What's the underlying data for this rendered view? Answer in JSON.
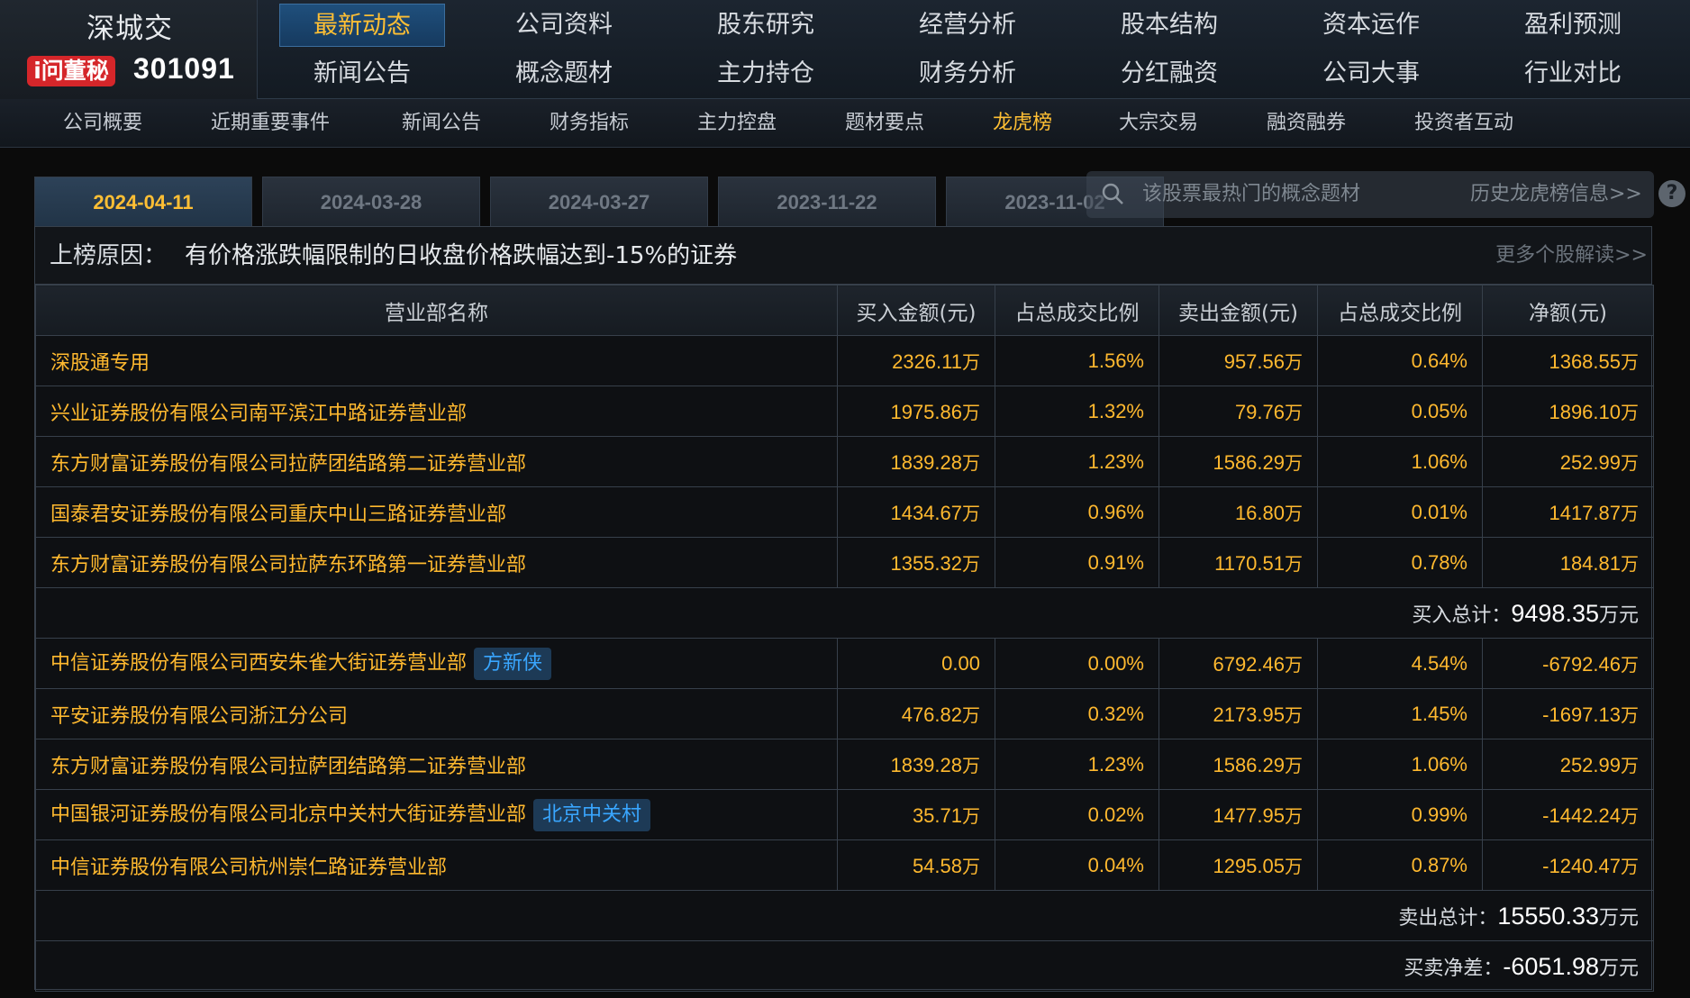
{
  "brand": {
    "exchange": "深城交",
    "iwen_badge": "i问董秘",
    "code": "301091"
  },
  "nav_main": {
    "row1": [
      "最新动态",
      "公司资料",
      "股东研究",
      "经营分析",
      "股本结构",
      "资本运作",
      "盈利预测"
    ],
    "row2": [
      "新闻公告",
      "概念题材",
      "主力持仓",
      "财务分析",
      "分红融资",
      "公司大事",
      "行业对比"
    ],
    "active": "最新动态"
  },
  "subnav": {
    "items": [
      "公司概要",
      "近期重要事件",
      "新闻公告",
      "财务指标",
      "主力控盘",
      "题材要点",
      "龙虎榜",
      "大宗交易",
      "融资融券",
      "投资者互动"
    ],
    "active": "龙虎榜"
  },
  "tabs": [
    "2024-04-11",
    "2024-03-28",
    "2024-03-27",
    "2023-11-22",
    "2023-11-02"
  ],
  "concept_search": {
    "label": "该股票最热门的概念题材"
  },
  "history_link": "历史龙虎榜信息>>",
  "help": "?",
  "reason": {
    "prefix": "上榜原因：",
    "text": "有价格涨跌幅限制的日收盘价格跌幅达到-15%的证券",
    "more": "更多个股解读>>"
  },
  "table": {
    "headers": [
      "营业部名称",
      "买入金额(元)",
      "占总成交比例",
      "卖出金额(元)",
      "占总成交比例",
      "净额(元)"
    ],
    "unit": "万",
    "buy_rows": [
      {
        "name": "深股通专用",
        "tag": "",
        "buy": "2326.11",
        "buy_unit": "万",
        "buy_pct": "1.56%",
        "sell": "957.56",
        "sell_pct": "0.64%",
        "net": "1368.55"
      },
      {
        "name": "兴业证券股份有限公司南平滨江中路证券营业部",
        "tag": "",
        "buy": "1975.86",
        "buy_unit": "万",
        "buy_pct": "1.32%",
        "sell": "79.76",
        "sell_pct": "0.05%",
        "net": "1896.10"
      },
      {
        "name": "东方财富证券股份有限公司拉萨团结路第二证券营业部",
        "tag": "",
        "buy": "1839.28",
        "buy_unit": "万",
        "buy_pct": "1.23%",
        "sell": "1586.29",
        "sell_pct": "1.06%",
        "net": "252.99"
      },
      {
        "name": "国泰君安证券股份有限公司重庆中山三路证券营业部",
        "tag": "",
        "buy": "1434.67",
        "buy_unit": "万",
        "buy_pct": "0.96%",
        "sell": "16.80",
        "sell_pct": "0.01%",
        "net": "1417.87"
      },
      {
        "name": "东方财富证券股份有限公司拉萨东环路第一证券营业部",
        "tag": "",
        "buy": "1355.32",
        "buy_unit": "万",
        "buy_pct": "0.91%",
        "sell": "1170.51",
        "sell_pct": "0.78%",
        "net": "184.81"
      }
    ],
    "buy_total": {
      "label": "买入总计：",
      "value": "9498.35",
      "unit": "万元"
    },
    "sell_rows": [
      {
        "name": "中信证券股份有限公司西安朱雀大街证券营业部",
        "tag": "方新侠",
        "buy": "0.00",
        "buy_unit": "",
        "buy_pct": "0.00%",
        "sell": "6792.46",
        "sell_pct": "4.54%",
        "net": "-6792.46"
      },
      {
        "name": "平安证券股份有限公司浙江分公司",
        "tag": "",
        "buy": "476.82",
        "buy_unit": "万",
        "buy_pct": "0.32%",
        "sell": "2173.95",
        "sell_pct": "1.45%",
        "net": "-1697.13"
      },
      {
        "name": "东方财富证券股份有限公司拉萨团结路第二证券营业部",
        "tag": "",
        "buy": "1839.28",
        "buy_unit": "万",
        "buy_pct": "1.23%",
        "sell": "1586.29",
        "sell_pct": "1.06%",
        "net": "252.99"
      },
      {
        "name": "中国银河证券股份有限公司北京中关村大街证券营业部",
        "tag": "北京中关村",
        "buy": "35.71",
        "buy_unit": "万",
        "buy_pct": "0.02%",
        "sell": "1477.95",
        "sell_pct": "0.99%",
        "net": "-1442.24"
      },
      {
        "name": "中信证券股份有限公司杭州崇仁路证券营业部",
        "tag": "",
        "buy": "54.58",
        "buy_unit": "万",
        "buy_pct": "0.04%",
        "sell": "1295.05",
        "sell_pct": "0.87%",
        "net": "-1240.47"
      }
    ],
    "sell_total": {
      "label": "卖出总计：",
      "value": "15550.33",
      "unit": "万元"
    },
    "net_total": {
      "label": "买卖净差：",
      "value": "-6051.98",
      "unit": "万元"
    }
  },
  "colors": {
    "accent": "#ffbf34",
    "value": "#ffb92f",
    "tag_text": "#39a6ff",
    "badge_red": "#d5262a"
  }
}
